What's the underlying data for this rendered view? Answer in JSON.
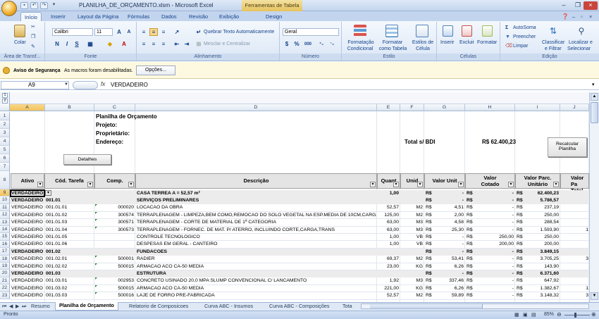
{
  "window": {
    "title": "PLANILHA_DE_ORÇAMENTO.xlsm - Microsoft Excel",
    "context_tab": "Ferramentas de Tabela"
  },
  "tabs": [
    "Início",
    "Inserir",
    "Layout da Página",
    "Fórmulas",
    "Dados",
    "Revisão",
    "Exibição",
    "Design"
  ],
  "ribbon": {
    "clipboard": {
      "paste": "Colar",
      "label": "Área de Transf..."
    },
    "font": {
      "name": "Calibri",
      "size": "11",
      "label": "Fonte",
      "bold": "N",
      "italic": "I",
      "underline": "S"
    },
    "alignment": {
      "wrap": "Quebrar Texto Automaticamente",
      "merge": "Mesclar e Centralizar",
      "label": "Alinhamento"
    },
    "number": {
      "format": "Geral",
      "label": "Número",
      "percent": "%",
      "thousands": "000"
    },
    "styles": {
      "cond1": "Formatação",
      "cond2": "Condicional",
      "table1": "Formatar",
      "table2": "como Tabela",
      "cell1": "Estilos de",
      "cell2": "Célula",
      "label": "Estilo"
    },
    "cells": {
      "insert": "Inserir",
      "delete": "Excluir",
      "format": "Formatar",
      "label": "Células"
    },
    "editing": {
      "autosum": "AutoSoma",
      "fill": "Preencher",
      "clear": "Limpar",
      "sort1": "Classificar",
      "sort2": "e Filtrar",
      "find1": "Localizar e",
      "find2": "Selecionar",
      "label": "Edição"
    }
  },
  "security": {
    "title": "Aviso de Segurança",
    "message": "As macros foram desabilitadas.",
    "button": "Opções..."
  },
  "formula_bar": {
    "cell_ref": "A9",
    "fx": "fx",
    "value": "VERDADEIRO"
  },
  "columns": [
    "A",
    "B",
    "C",
    "D",
    "E",
    "F",
    "G",
    "H",
    "I",
    "J"
  ],
  "top": {
    "title": "Planilha de Orçamento",
    "projeto": "Projeto:",
    "proprietario": "Proprietário:",
    "endereco": "Endereço:",
    "total_label": "Total s/ BDI",
    "total_value": "R$ 62.400,23",
    "recalc1": "Recalcular",
    "recalc2": "Planilha",
    "detalhes": "Detalhes"
  },
  "headers": {
    "ativo": "Ativo",
    "cod": "Cód. Tarefa",
    "comp": "Comp.",
    "desc": "Descrição",
    "quant": "Quant",
    "unid": "Unid",
    "vunit": "Valor Unit",
    "vcot1": "Valor",
    "vcot2": "Cotado",
    "vparc1": "Valor Parc.",
    "vparc2": "Unitário",
    "vpt1": "Valor Pa",
    "vpt2": "Total"
  },
  "rows": [
    {
      "n": "9",
      "a": "VERDADEIRO",
      "b": "",
      "c": "",
      "d": "CASA TERREA A = 52,57 m²",
      "e": "1,00",
      "f": "",
      "g": "R$",
      "g2": "-",
      "h": "R$",
      "h2": "-",
      "i": "R$",
      "i2": "62.400,23",
      "j": "",
      "bold": true
    },
    {
      "n": "10",
      "a": "VERDADEIRO",
      "b": "001.01",
      "c": "",
      "d": "SERVIÇOS PRELIMINARES",
      "e": "",
      "f": "",
      "g": "R$",
      "g2": "-",
      "h": "R$",
      "h2": "-",
      "i": "R$",
      "i2": "5.786,57",
      "j": "",
      "bold": true
    },
    {
      "n": "11",
      "a": "VERDADEIRO",
      "b": "001.01.01",
      "c": "000020",
      "d": "LOCACAO DA OBRA",
      "e": "52,57",
      "f": "M2",
      "g": "R$",
      "g2": "4,51",
      "h": "R$",
      "h2": "-",
      "i": "R$",
      "i2": "237,19",
      "j": ""
    },
    {
      "n": "12",
      "a": "VERDADEIRO",
      "b": "001.01.02",
      "c": "300574",
      "d": "TERRAPLENAGEM - LIMPEZA,BEM COMO,REMOCAO DO SOLO VEGETAL NA ESP.MEDIA DE 10CM,CARGA E",
      "e": "125,00",
      "f": "M2",
      "g": "R$",
      "g2": "2,00",
      "h": "R$",
      "h2": "-",
      "i": "R$",
      "i2": "250,00",
      "j": ""
    },
    {
      "n": "13",
      "a": "VERDADEIRO",
      "b": "001.01.03",
      "c": "300571",
      "d": "TERRAPLENAGEM - CORTE DE MATERIAL DE 1ª CATEGORIA",
      "e": "63,00",
      "f": "M3",
      "g": "R$",
      "g2": "4,58",
      "h": "R$",
      "h2": "-",
      "i": "R$",
      "i2": "288,54",
      "j": ""
    },
    {
      "n": "14",
      "a": "VERDADEIRO",
      "b": "001.01.04",
      "c": "300573",
      "d": "TERRAPLENAGEM - FORNEC. DE MAT. P/ ATERRO, INCLUINDO CORTE,CARGA,TRANS",
      "e": "63,00",
      "f": "M3",
      "g": "R$",
      "g2": "25,30",
      "h": "R$",
      "h2": "-",
      "i": "R$",
      "i2": "1.593,90",
      "j": "1"
    },
    {
      "n": "15",
      "a": "VERDADEIRO",
      "b": "001.01.05",
      "c": "",
      "d": "CONTROLE TECNOLOGICO",
      "e": "1,00",
      "f": "VB",
      "g": "R$",
      "g2": "-",
      "h": "R$",
      "h2": "250,00",
      "i": "R$",
      "i2": "250,00",
      "j": ""
    },
    {
      "n": "16",
      "a": "VERDADEIRO",
      "b": "001.01.06",
      "c": "",
      "d": "DESPESAS EM GERAL - CANTEIRO",
      "e": "1,00",
      "f": "VB",
      "g": "R$",
      "g2": "-",
      "h": "R$",
      "h2": "200,00",
      "i": "R$",
      "i2": "200,00",
      "j": ""
    },
    {
      "n": "17",
      "a": "VERDADEIRO",
      "b": "001.02",
      "c": "",
      "d": "FUNDACOES",
      "e": "",
      "f": "",
      "g": "R$",
      "g2": "-",
      "h": "R$",
      "h2": "-",
      "i": "R$",
      "i2": "3.849,15",
      "j": "",
      "bold": true
    },
    {
      "n": "18",
      "a": "VERDADEIRO",
      "b": "001.02.01",
      "c": "500001",
      "d": "RADIER",
      "e": "69,37",
      "f": "M2",
      "g": "R$",
      "g2": "53,41",
      "h": "R$",
      "h2": "-",
      "i": "R$",
      "i2": "3.705,25",
      "j": "3"
    },
    {
      "n": "19",
      "a": "VERDADEIRO",
      "b": "001.02.02",
      "c": "500015",
      "d": "ARMACAO ACO CA-50 MEDIA",
      "e": "23,00",
      "f": "KG",
      "g": "R$",
      "g2": "6,26",
      "h": "R$",
      "h2": "-",
      "i": "R$",
      "i2": "143,90",
      "j": ""
    },
    {
      "n": "20",
      "a": "VERDADEIRO",
      "b": "001.03",
      "c": "",
      "d": "ESTRUTURA",
      "e": "",
      "f": "",
      "g": "R$",
      "g2": "-",
      "h": "R$",
      "h2": "-",
      "i": "R$",
      "i2": "6.371,60",
      "j": "",
      "bold": true
    },
    {
      "n": "21",
      "a": "VERDADEIRO",
      "b": "001.03.01",
      "c": "002953",
      "d": "CONCRETO USINADO 20,0 MPA SLUMP CONVENCIONAL C/ LANCAMENTO",
      "e": "1,92",
      "f": "M3",
      "g": "R$",
      "g2": "337,46",
      "h": "R$",
      "h2": "-",
      "i": "R$",
      "i2": "647,92",
      "j": ""
    },
    {
      "n": "22",
      "a": "VERDADEIRO",
      "b": "001.03.02",
      "c": "500015",
      "d": "ARMACAO ACO CA-50 MEDIA",
      "e": "221,00",
      "f": "KG",
      "g": "R$",
      "g2": "6,26",
      "h": "R$",
      "h2": "-",
      "i": "R$",
      "i2": "1.382,67",
      "j": "1"
    },
    {
      "n": "23",
      "a": "VERDADEIRO",
      "b": "001.03.03",
      "c": "500016",
      "d": "LAJE DE FORRO PRE-FABRICADA",
      "e": "52,57",
      "f": "M2",
      "g": "R$",
      "g2": "59,89",
      "h": "R$",
      "h2": "-",
      "i": "R$",
      "i2": "3.148,32",
      "j": "3"
    }
  ],
  "sheets": [
    "Resumo",
    "Planilha de Orçamento",
    "Relatorio de Composicoes",
    "Curva ABC - Insumos",
    "Curva ABC - Composições",
    "Tota"
  ],
  "status": {
    "ready": "Pronto",
    "zoom": "85%"
  },
  "colors": {
    "accent": "#15428b",
    "ribbon": "#dbe7f6",
    "header_fill": "#e4e4e4",
    "security_bar": "#fdf9e0"
  }
}
